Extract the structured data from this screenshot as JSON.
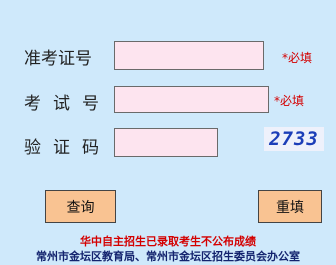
{
  "form": {
    "ticket_label": "准考证号",
    "ticket_value": "",
    "ticket_hint": "*必填",
    "exam_label": "考试号",
    "exam_value": "",
    "exam_hint": "*必填",
    "code_label": "验证码",
    "code_value": "",
    "captcha_text": "2733"
  },
  "buttons": {
    "query_label": "查询",
    "reset_label": "重填"
  },
  "footer": {
    "notice": "华中自主招生已录取考生不公布成绩",
    "org": "常州市金坛区教育局、常州市金坛区招生委员会办公室"
  }
}
